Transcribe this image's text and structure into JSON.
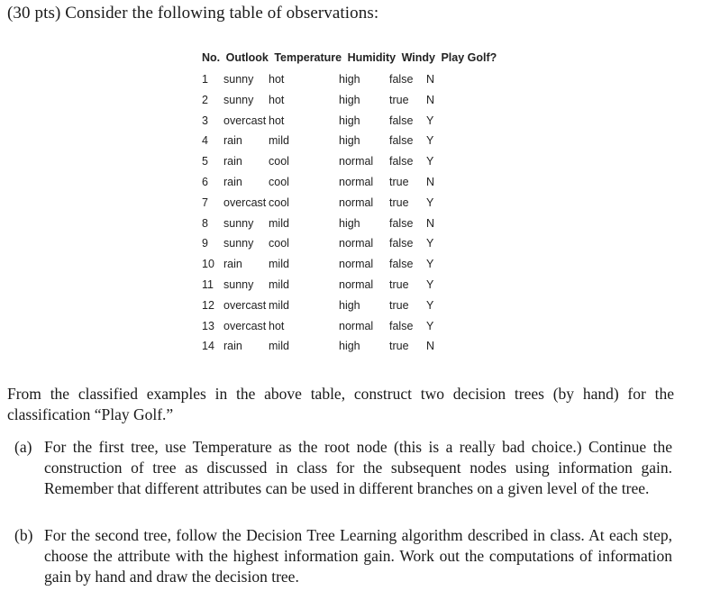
{
  "intro": "(30 pts) Consider the following table of observations:",
  "table": {
    "headers": [
      "No.",
      "Outlook",
      "Temperature",
      "Humidity",
      "Windy",
      "Play Golf?"
    ],
    "rows": [
      [
        "1",
        "sunny",
        "hot",
        "high",
        "false",
        "N"
      ],
      [
        "2",
        "sunny",
        "hot",
        "high",
        "true",
        "N"
      ],
      [
        "3",
        "overcast",
        "hot",
        "high",
        "false",
        "Y"
      ],
      [
        "4",
        "rain",
        "mild",
        "high",
        "false",
        "Y"
      ],
      [
        "5",
        "rain",
        "cool",
        "normal",
        "false",
        "Y"
      ],
      [
        "6",
        "rain",
        "cool",
        "normal",
        "true",
        "N"
      ],
      [
        "7",
        "overcast",
        "cool",
        "normal",
        "true",
        "Y"
      ],
      [
        "8",
        "sunny",
        "mild",
        "high",
        "false",
        "N"
      ],
      [
        "9",
        "sunny",
        "cool",
        "normal",
        "false",
        "Y"
      ],
      [
        "10",
        "rain",
        "mild",
        "normal",
        "false",
        "Y"
      ],
      [
        "11",
        "sunny",
        "mild",
        "normal",
        "true",
        "Y"
      ],
      [
        "12",
        "overcast",
        "mild",
        "high",
        "true",
        "Y"
      ],
      [
        "13",
        "overcast",
        "hot",
        "normal",
        "false",
        "Y"
      ],
      [
        "14",
        "rain",
        "mild",
        "high",
        "true",
        "N"
      ]
    ]
  },
  "paragraph": "From the classified examples in the above table, construct two decision trees (by hand) for the classification “Play Golf.”",
  "items": [
    {
      "label": "(a)",
      "text": "For the first tree, use Temperature as the root node (this is a really bad choice.) Continue the construction of tree as discussed in class for the subsequent nodes using information gain. Remember that different attributes can be used in different branches on a given level of the tree."
    },
    {
      "label": "(b)",
      "text": "For the second tree, follow the Decision Tree Learning algorithm described in class. At each step, choose the attribute with the highest information gain. Work out the computations of information gain by hand and draw the decision tree."
    }
  ]
}
